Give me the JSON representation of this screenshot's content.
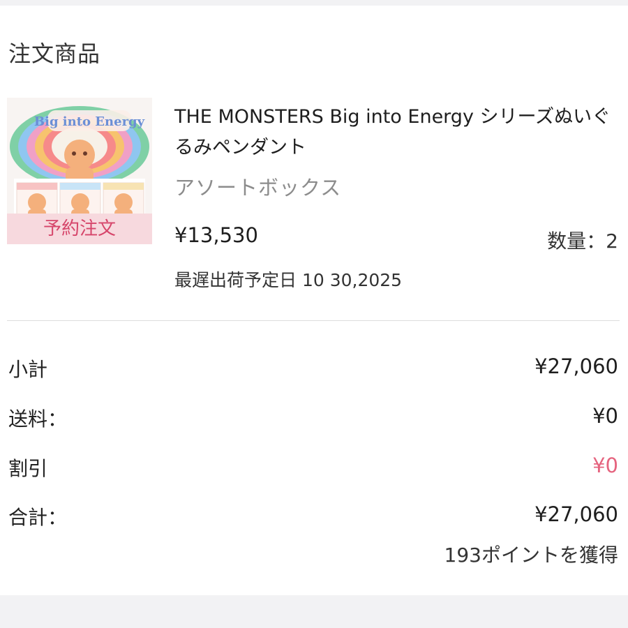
{
  "section": {
    "title": "注文商品"
  },
  "product": {
    "image_alt": "THE MONSTERS Big into Energy box",
    "image_logo_text": "Big into Energy",
    "badge": "予約注文",
    "name": "THE MONSTERS Big into Energy シリーズぬいぐるみペンダント",
    "variant": "アソートボックス",
    "price": "¥13,530",
    "quantity": "数量：2",
    "ship_date": "最遅出荷予定日 10 30,2025"
  },
  "summary": {
    "subtotal": {
      "label": "小計",
      "value": "¥27,060"
    },
    "shipping": {
      "label": "送料：",
      "value": "¥0"
    },
    "discount": {
      "label": "割引",
      "value": "¥0"
    },
    "total": {
      "label": "合計：",
      "value": "¥27,060"
    },
    "points": "193ポイントを獲得"
  },
  "colors": {
    "badge_bg": "#f7d9de",
    "badge_text": "#d6456a",
    "discount_text": "#e5637e",
    "page_bg": "#f2f2f4"
  }
}
